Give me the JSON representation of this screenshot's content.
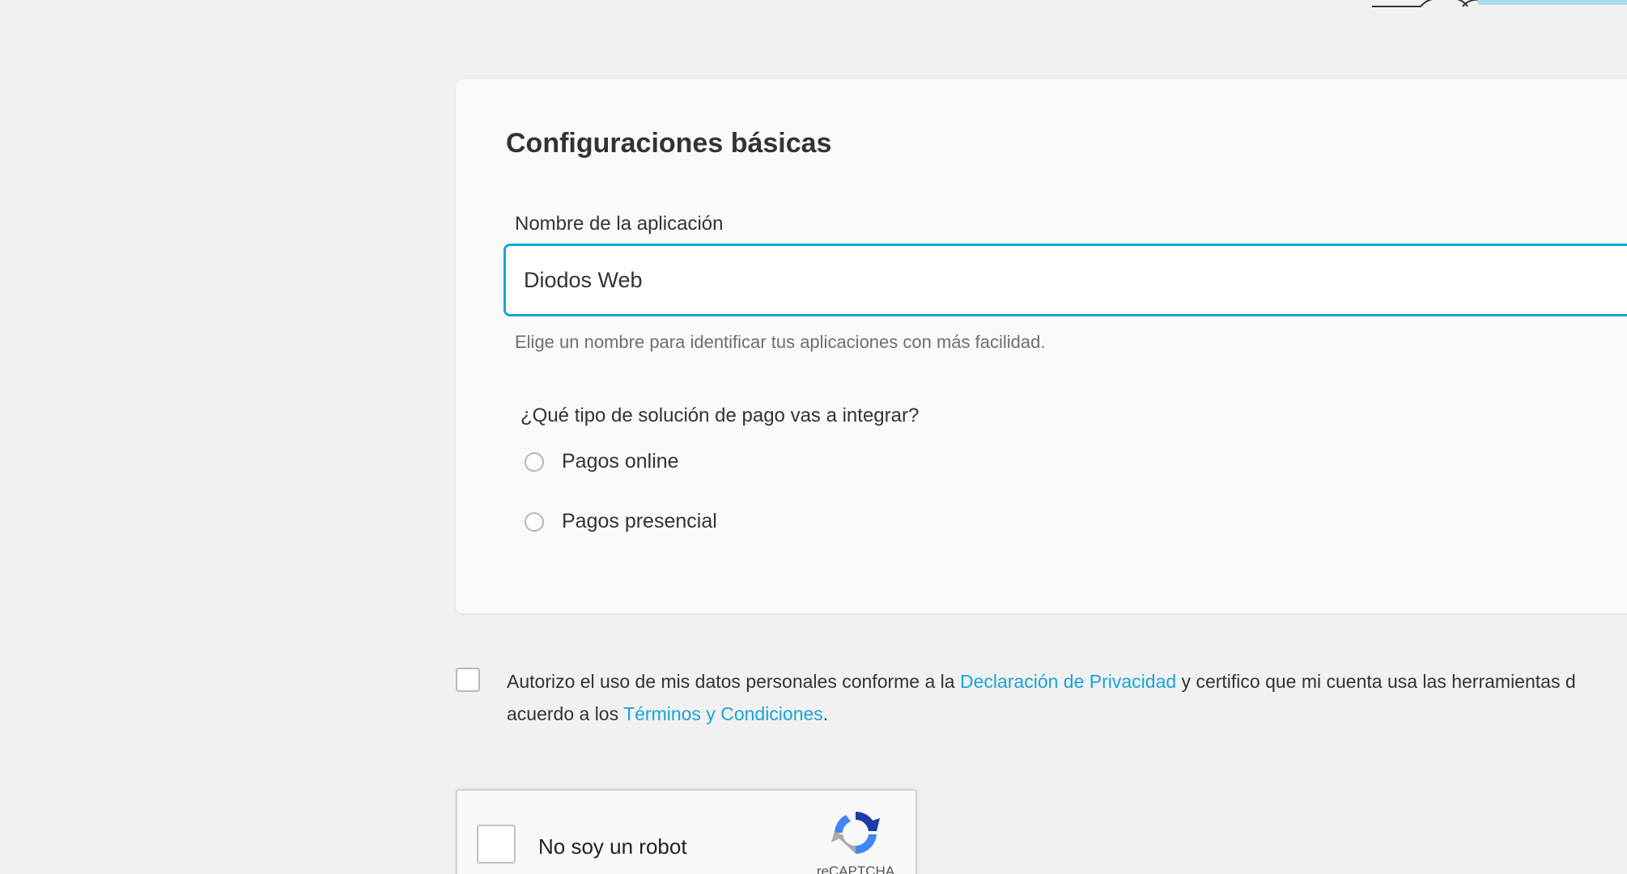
{
  "card": {
    "title": "Configuraciones básicas",
    "app_name": {
      "label": "Nombre de la aplicación",
      "value": "Diodos Web",
      "help": "Elige un nombre para identificar tus aplicaciones con más facilidad."
    },
    "payment_type": {
      "question": "¿Qué tipo de solución de pago vas a integrar?",
      "options": [
        {
          "label": "Pagos online",
          "selected": false
        },
        {
          "label": "Pagos presencial",
          "selected": false
        }
      ]
    }
  },
  "consent": {
    "checked": false,
    "text_1": "Autorizo el uso de mis datos personales conforme a la ",
    "privacy_link": "Declaración de Privacidad",
    "text_2": " y certifico que mi cuenta usa las herramientas d",
    "text_3": "acuerdo a los ",
    "terms_link": "Términos y Condiciones",
    "text_4": "."
  },
  "recaptcha": {
    "label": "No soy un robot",
    "brand": "reCAPTCHA"
  },
  "colors": {
    "accent": "#19a4d9",
    "background": "#f1f1f1",
    "card": "#fafafa"
  },
  "icons": {
    "header_decoration": "header-illustration-icon",
    "recaptcha_logo": "recaptcha-logo-icon"
  }
}
